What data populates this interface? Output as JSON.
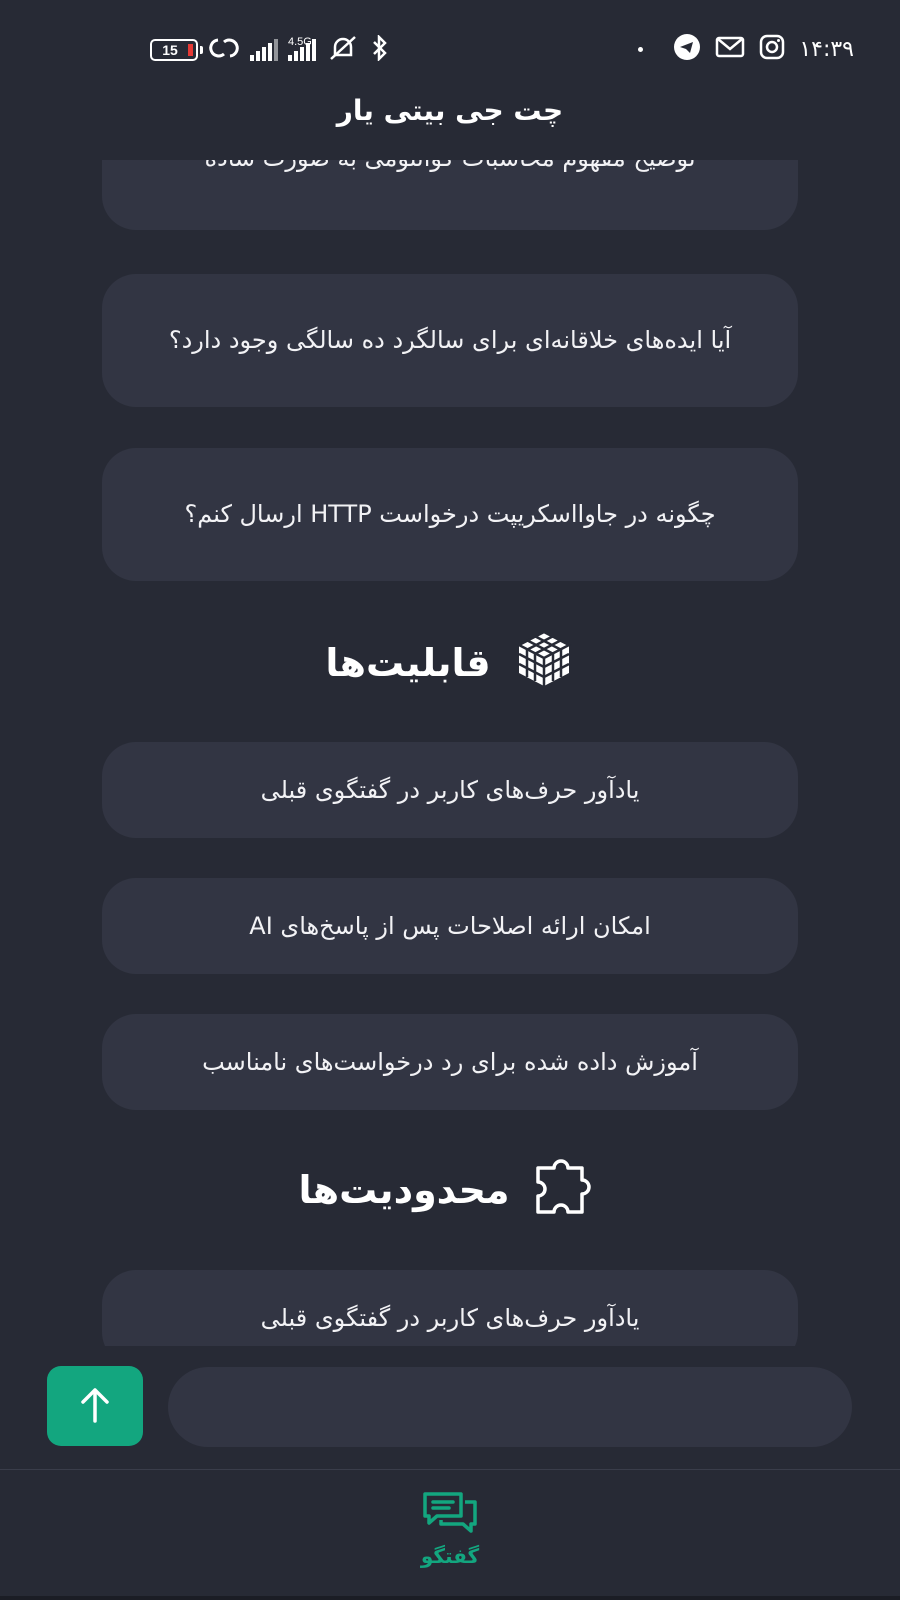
{
  "status_bar": {
    "battery_level": "15",
    "network_label": "4.5G",
    "time": "۱۴:۳۹"
  },
  "header": {
    "title": "چت جی بیتی یار"
  },
  "examples": [
    "توضیح مفهوم محاسبات کوانتومی به صورت ساده",
    "آیا ایده‌های خلاقانه‌ای برای سالگرد ده سالگی وجود دارد؟",
    "چگونه در جاوااسکریپت درخواست HTTP ارسال کنم؟"
  ],
  "capabilities": {
    "heading": "قابلیت‌ها",
    "icon": "cube-icon",
    "items": [
      "یادآور حرف‌های کاربر در گفتگوی قبلی",
      "امکان ارائه اصلاحات پس از پاسخ‌های AI",
      "آموزش داده شده برای رد درخواست‌های نامناسب"
    ]
  },
  "limitations": {
    "heading": "محدودیت‌ها",
    "icon": "puzzle-icon",
    "items": [
      "یادآور حرف‌های کاربر در گفتگوی قبلی"
    ]
  },
  "composer": {
    "send_icon": "arrow-up-icon",
    "input_value": ""
  },
  "bottom_nav": {
    "items": [
      {
        "label": "گفتگو",
        "icon": "chat-bubbles-icon"
      }
    ]
  },
  "colors": {
    "background": "#272a35",
    "card": "#323543",
    "accent": "#13a67f"
  }
}
